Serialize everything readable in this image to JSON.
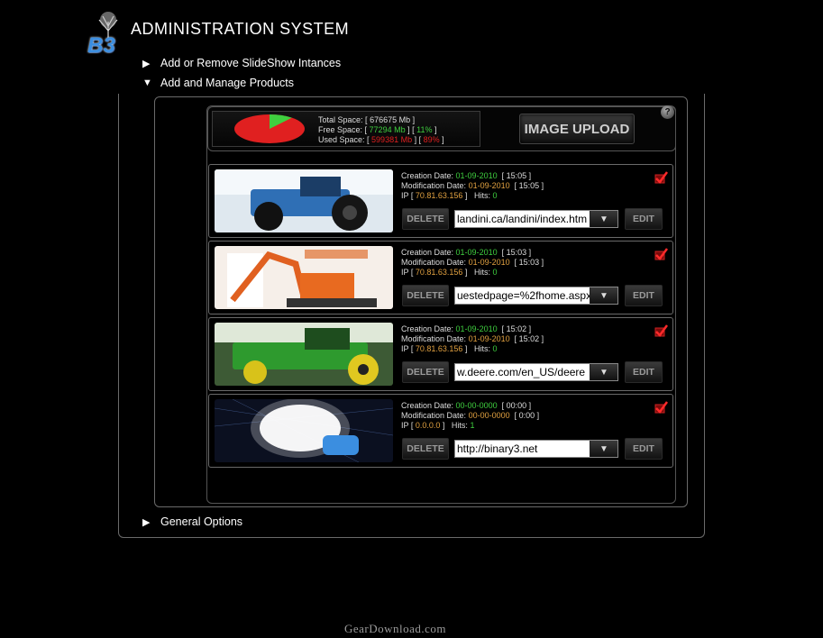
{
  "app": {
    "title": "ADMINISTRATION  SYSTEM",
    "logo_text": "B3"
  },
  "nav": [
    {
      "arrow": "▶",
      "label": "Add or Remove SlideShow Intances"
    },
    {
      "arrow": "▼",
      "label": "Add and Manage Products"
    },
    {
      "arrow": "▶",
      "label": "General Options"
    }
  ],
  "space": {
    "total_label": "Total Space: [",
    "total_value": "676675 Mb",
    "total_end": " ]",
    "free_label": "Free Space: [",
    "free_value": "77294 Mb",
    "free_mid": " ] [",
    "free_percent": "11%",
    "free_end": " ]",
    "used_label": "Used Space: [",
    "used_value": "599381 Mb",
    "used_mid": " ] [",
    "used_percent": "89%",
    "used_end": " ]",
    "free_fraction": 0.11,
    "free_color": "#3fcf3f",
    "used_color": "#e02020"
  },
  "upload_label": "IMAGE UPLOAD",
  "help_icon": "?",
  "product_labels": {
    "creation": "Creation Date:",
    "modification": "Modification Date:",
    "ip": "IP [",
    "ip_end": " ]",
    "hits": "Hits:",
    "delete": "DELETE",
    "edit": "EDIT",
    "arrow": "▼"
  },
  "products": [
    {
      "creation_date": "01-09-2010",
      "creation_time": "[ 15:05 ]",
      "mod_date": "01-09-2010",
      "mod_time": "[ 15:05 ]",
      "ip": "70.81.63.156",
      "hits": "0",
      "url": "landini.ca/landini/index.htm",
      "image": "tractor-blue-icon"
    },
    {
      "creation_date": "01-09-2010",
      "creation_time": "[ 15:03 ]",
      "mod_date": "01-09-2010",
      "mod_time": "[ 15:03 ]",
      "ip": "70.81.63.156",
      "hits": "0",
      "url": "uestedpage=%2fhome.aspx",
      "image": "excavator-orange-icon"
    },
    {
      "creation_date": "01-09-2010",
      "creation_time": "[ 15:02 ]",
      "mod_date": "01-09-2010",
      "mod_time": "[ 15:02 ]",
      "ip": "70.81.63.156",
      "hits": "0",
      "url": "w.deere.com/en_US/deere",
      "image": "tractor-green-icon"
    },
    {
      "creation_date": "00-00-0000",
      "creation_time": "[ 00:00 ]",
      "mod_date": "00-00-0000",
      "mod_time": "[ 0:00 ]",
      "ip": "0.0.0.0",
      "hits": "1",
      "url": "http://binary3.net",
      "image": "b3-logo-glow-icon"
    }
  ],
  "watermark": "GearDownload.com"
}
